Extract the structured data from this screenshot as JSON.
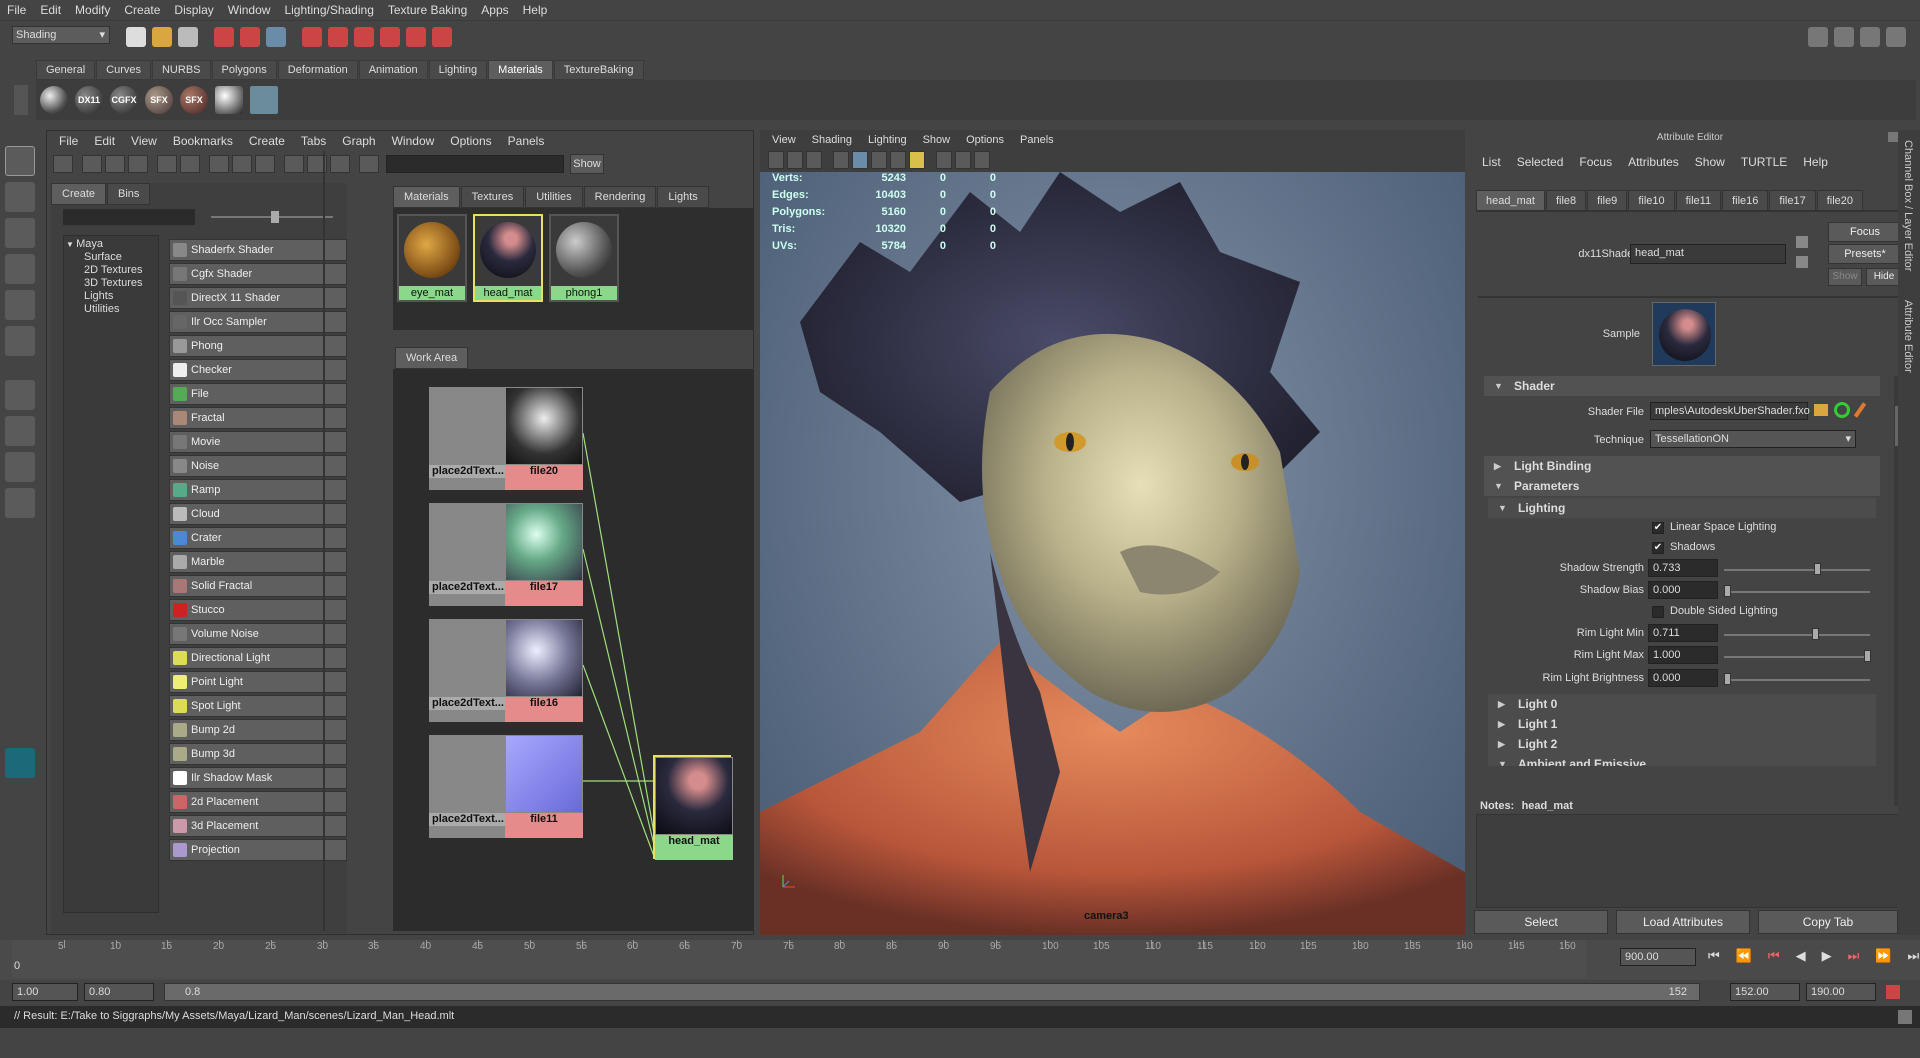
{
  "menubar": [
    "File",
    "Edit",
    "Modify",
    "Create",
    "Display",
    "Window",
    "Lighting/Shading",
    "Texture Baking",
    "Apps",
    "Help"
  ],
  "mode": "Shading",
  "shelf_tabs": [
    "General",
    "Curves",
    "NURBS",
    "Polygons",
    "Deformation",
    "Animation",
    "Lighting",
    "Materials",
    "TextureBaking"
  ],
  "shelf_active": "Materials",
  "shelf_icons": [
    "DX11",
    "CGFX",
    "SFX",
    "SFX"
  ],
  "hypershade": {
    "menu": [
      "File",
      "Edit",
      "View",
      "Bookmarks",
      "Create",
      "Tabs",
      "Graph",
      "Window",
      "Options",
      "Panels"
    ],
    "show_button": "Show",
    "left_tabs": [
      "Create",
      "Bins"
    ],
    "tree": [
      "Maya",
      "Surface",
      "2D Textures",
      "3D Textures",
      "Lights",
      "Utilities"
    ],
    "nodes": [
      "Shaderfx Shader",
      "Cgfx Shader",
      "DirectX 11 Shader",
      "Ilr Occ Sampler",
      "Phong",
      "Checker",
      "File",
      "Fractal",
      "Movie",
      "Noise",
      "Ramp",
      "Cloud",
      "Crater",
      "Marble",
      "Solid Fractal",
      "Stucco",
      "Volume Noise",
      "Directional Light",
      "Point Light",
      "Spot Light",
      "Bump 2d",
      "Bump 3d",
      "Ilr Shadow Mask",
      "2d Placement",
      "3d Placement",
      "Projection"
    ],
    "top_tabs": [
      "Materials",
      "Textures",
      "Utilities",
      "Rendering",
      "Lights"
    ],
    "materials": [
      "eye_mat",
      "head_mat",
      "phong1"
    ],
    "work_area_tab": "Work Area",
    "graph_nodes": {
      "place": [
        "place2dText...",
        "place2dText...",
        "place2dText...",
        "place2dText..."
      ],
      "files": [
        "file20",
        "file17",
        "file16",
        "file11"
      ],
      "shader": "head_mat"
    }
  },
  "viewport": {
    "menu": [
      "View",
      "Shading",
      "Lighting",
      "Show",
      "Options",
      "Panels"
    ],
    "hud": [
      {
        "label": "Verts:",
        "v": "5243",
        "a": "0",
        "b": "0"
      },
      {
        "label": "Edges:",
        "v": "10403",
        "a": "0",
        "b": "0"
      },
      {
        "label": "Polygons:",
        "v": "5160",
        "a": "0",
        "b": "0"
      },
      {
        "label": "Tris:",
        "v": "10320",
        "a": "0",
        "b": "0"
      },
      {
        "label": "UVs:",
        "v": "5784",
        "a": "0",
        "b": "0"
      }
    ],
    "camera": "camera3"
  },
  "attr": {
    "title": "Attribute Editor",
    "menu": [
      "List",
      "Selected",
      "Focus",
      "Attributes",
      "Show",
      "TURTLE",
      "Help"
    ],
    "tabs": [
      "head_mat",
      "file8",
      "file9",
      "file10",
      "file11",
      "file16",
      "file17",
      "file20"
    ],
    "shader_type_label": "dx11Shader:",
    "shader_name": "head_mat",
    "focus": "Focus",
    "presets": "Presets*",
    "show": "Show",
    "hide": "Hide",
    "sample": "Sample",
    "section_shader": "Shader",
    "shader_file_label": "Shader File",
    "shader_file": "mples\\AutodeskUberShader.fxo",
    "technique_label": "Technique",
    "technique": "TessellationON",
    "section_light_binding": "Light Binding",
    "section_parameters": "Parameters",
    "section_lighting": "Lighting",
    "linear_space": "Linear Space Lighting",
    "shadows": "Shadows",
    "shadow_strength_label": "Shadow Strength",
    "shadow_strength": "0.733",
    "shadow_bias_label": "Shadow Bias",
    "shadow_bias": "0.000",
    "double_sided": "Double Sided Lighting",
    "rim_min_label": "Rim Light Min",
    "rim_min": "0.711",
    "rim_max_label": "Rim Light Max",
    "rim_max": "1.000",
    "rim_bright_label": "Rim Light Brightness",
    "rim_bright": "0.000",
    "light0": "Light 0",
    "light1": "Light 1",
    "light2": "Light 2",
    "ambient": "Ambient and Emissive",
    "notes_label": "Notes:",
    "notes_name": "head_mat",
    "btn_select": "Select",
    "btn_load": "Load Attributes",
    "btn_copy": "Copy Tab",
    "side_tabs": [
      "Channel Box / Layer Editor",
      "Attribute Editor"
    ]
  },
  "timeline": {
    "ticks": [
      "5",
      "10",
      "15",
      "20",
      "25",
      "30",
      "35",
      "40",
      "45",
      "50",
      "55",
      "60",
      "65",
      "70",
      "75",
      "80",
      "85",
      "90",
      "95",
      "100",
      "105",
      "110",
      "115",
      "120",
      "125",
      "130",
      "135",
      "140",
      "145",
      "150"
    ],
    "start": "0",
    "current": "900.00"
  },
  "range": {
    "a": "1.00",
    "b": "0.80",
    "c": "0.8",
    "end_inner": "152",
    "end": "152.00",
    "max": "190.00"
  },
  "command": "// Result: E:/Take to Siggraphs/My Assets/Maya/Lizard_Man/scenes/Lizard_Man_Head.mlt"
}
